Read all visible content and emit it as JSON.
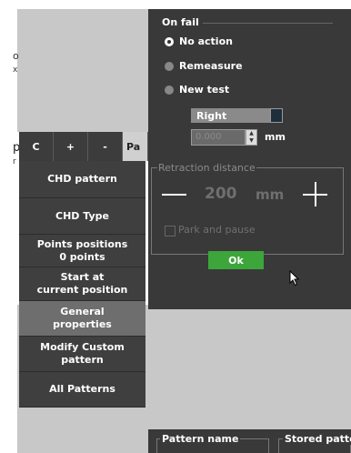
{
  "background_text": {
    "line1": "o",
    "line2": "x",
    "line3": "p",
    "line4": "r"
  },
  "tabs": [
    {
      "label": "C"
    },
    {
      "label": "+"
    },
    {
      "label": "-"
    },
    {
      "label": "Pa"
    }
  ],
  "menu": {
    "items": [
      {
        "label": "CHD pattern"
      },
      {
        "label": "CHD Type"
      },
      {
        "label": "Points positions\n0 points"
      },
      {
        "label": "Start at\ncurrent position"
      },
      {
        "label": "General\nproperties"
      },
      {
        "label": "Modify Custom pattern"
      },
      {
        "label": "All Patterns"
      }
    ],
    "selected_index": 4
  },
  "dialog": {
    "on_fail_title": "On fail",
    "options": [
      {
        "label": "No action",
        "selected": true
      },
      {
        "label": "Remeasure",
        "selected": false
      },
      {
        "label": "New test",
        "selected": false
      }
    ],
    "side_select": "Right",
    "offset_value": "0.000",
    "offset_unit": "mm",
    "retraction_title": "Retraction distance",
    "retraction_value": "200",
    "retraction_unit": "mm",
    "park_label": "Park and pause",
    "ok_label": "Ok"
  },
  "bottom": {
    "pattern_name_label": "Pattern name",
    "stored_label": "Stored patter"
  },
  "colors": {
    "dialog_bg": "#393939",
    "ok_green": "#3ca63a",
    "menu_bg": "#3f3f3f",
    "menu_selected": "#6e6e6e"
  }
}
